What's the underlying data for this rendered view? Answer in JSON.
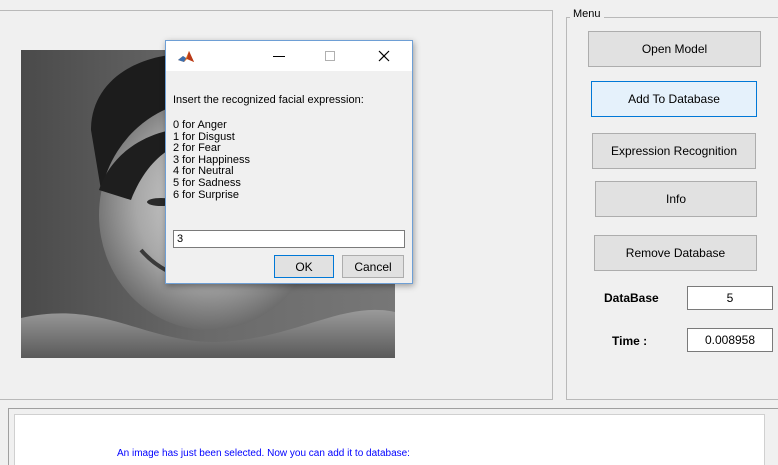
{
  "menu": {
    "title": "Menu",
    "buttons": {
      "open_model": "Open Model",
      "add_to_database": "Add To Database",
      "expression_recognition": "Expression Recognition",
      "info": "Info",
      "remove_database": "Remove Database"
    },
    "database_label": "DataBase",
    "database_value": "5",
    "time_label": "Time :",
    "time_value": "0.008958"
  },
  "dialog": {
    "prompt": "Insert the recognized facial expression:",
    "options": [
      "0 for Anger",
      "1 for Disgust",
      "2 for Fear",
      "3 for Happiness",
      "4 for Neutral",
      "5 for Sadness",
      "6 for Surprise"
    ],
    "input_value": "3",
    "ok_label": "OK",
    "cancel_label": "Cancel",
    "icons": {
      "app": "matlab-icon",
      "minimize": "minimize-icon",
      "maximize": "maximize-icon",
      "close": "close-icon"
    }
  },
  "log": {
    "message": "An image has just been selected. Now you can add it to database:"
  },
  "colors": {
    "log_text": "#0000ff",
    "focus_border": "#0078d7",
    "dialog_border": "#6e9fd5"
  }
}
